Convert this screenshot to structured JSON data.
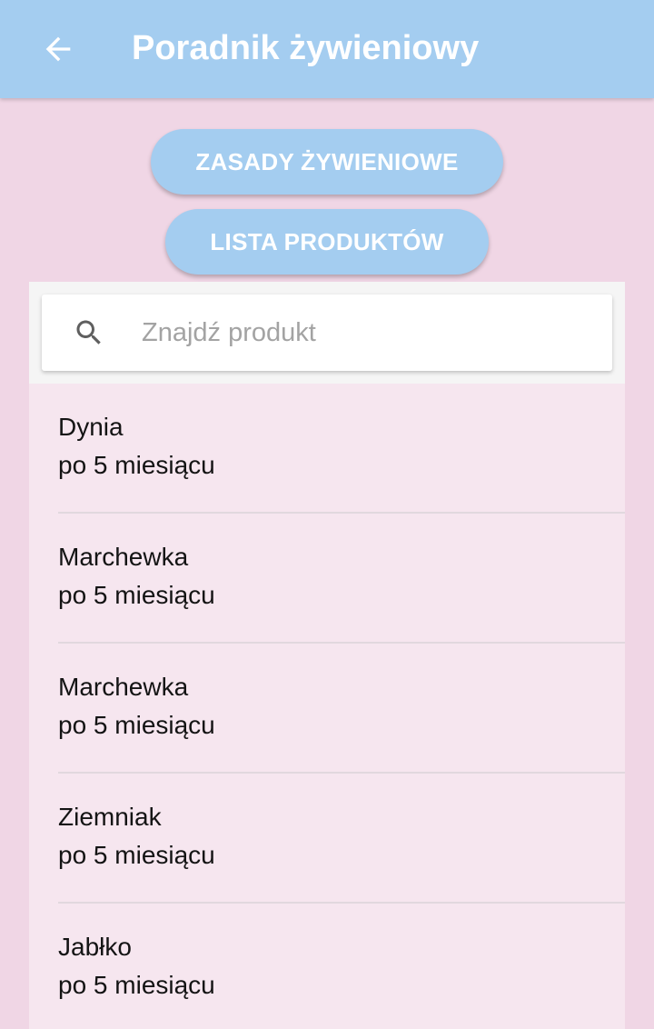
{
  "appbar": {
    "title": "Poradnik żywieniowy",
    "back_icon": "arrow-back-icon"
  },
  "buttons": {
    "rules_label": "ZASADY ŻYWIENIOWE",
    "products_label": "LISTA PRODUKTÓW"
  },
  "search": {
    "placeholder": "Znajdź produkt",
    "value": "",
    "icon": "search-icon"
  },
  "products": [
    {
      "name": "Dynia",
      "age": "po 5 miesiącu"
    },
    {
      "name": "Marchewka",
      "age": "po 5 miesiącu"
    },
    {
      "name": "Marchewka",
      "age": "po 5 miesiącu"
    },
    {
      "name": "Ziemniak",
      "age": "po 5 miesiącu"
    },
    {
      "name": "Jabłko",
      "age": "po 5 miesiącu"
    }
  ],
  "colors": {
    "primary": "#a4cdf0",
    "background": "#f0d6e5",
    "list_background": "#f6e6ef"
  }
}
